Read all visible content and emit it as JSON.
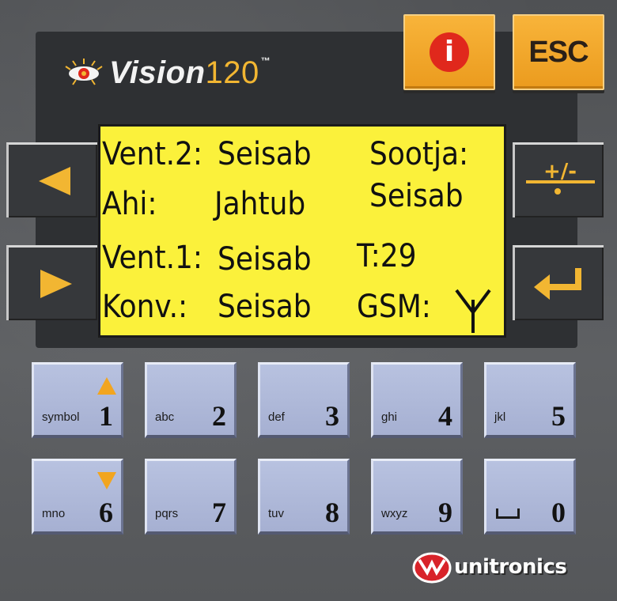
{
  "device": {
    "logo_text": "Vision",
    "logo_number": "120",
    "logo_tm": "™",
    "brand": "unitronics"
  },
  "top_keys": {
    "info_label": "i",
    "esc_label": "ESC"
  },
  "side_keys": {
    "left_up_icon": "arrow-left-icon",
    "left_down_icon": "arrow-right-icon",
    "right_up_icon": "plus-minus-icon",
    "right_up_label": "+/-",
    "right_down_icon": "enter-icon"
  },
  "display": {
    "row1_left_label": "Vent.2:",
    "row1_left_value": "Seisab",
    "row1_right_label": "Sootja:",
    "row2_left_label": "Ahi:",
    "row2_left_value": "Jahtub",
    "row2_right_value": "Seisab",
    "row3_left_label": "Vent.1:",
    "row3_left_value": "Seisab",
    "row3_right": "T:29",
    "row4_left_label": "Konv.:",
    "row4_left_value": "Seisab",
    "row4_right_label": "GSM:",
    "row4_icon": "antenna-icon"
  },
  "keypad": {
    "keys": [
      {
        "num": "1",
        "letters": "symbol"
      },
      {
        "num": "2",
        "letters": "abc"
      },
      {
        "num": "3",
        "letters": "def"
      },
      {
        "num": "4",
        "letters": "ghi"
      },
      {
        "num": "5",
        "letters": "jkl"
      },
      {
        "num": "6",
        "letters": "mno"
      },
      {
        "num": "7",
        "letters": "pqrs"
      },
      {
        "num": "8",
        "letters": "tuv"
      },
      {
        "num": "9",
        "letters": "wxyz"
      },
      {
        "num": "0",
        "letters": ""
      }
    ]
  },
  "colors": {
    "lcd_background": "#fbf13b",
    "key_orange": "#f2b632",
    "keypad_blue": "#b0bad9",
    "bezel": "#2e3033"
  }
}
